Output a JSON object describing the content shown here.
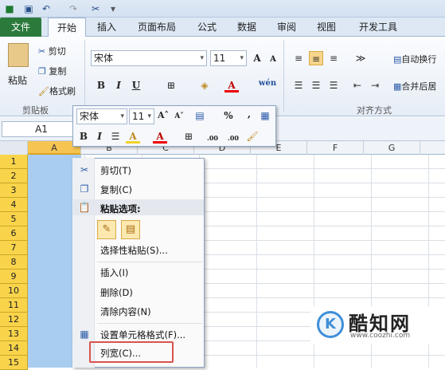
{
  "tabs": {
    "file": "文件",
    "home": "开始",
    "insert": "插入",
    "layout": "页面布局",
    "formula": "公式",
    "data": "数据",
    "review": "审阅",
    "view": "视图",
    "dev": "开发工具"
  },
  "ribbon": {
    "paste": "粘贴",
    "cut": "剪切",
    "copy": "复制",
    "format_painter": "格式刷",
    "clipboard_group": "剪贴板",
    "font_name": "宋体",
    "font_size": "11",
    "wrap": "自动换行",
    "merge": "合并后居",
    "align_group": "对齐方式",
    "bold": "B",
    "italic": "I",
    "underline": "U",
    "font_color": "A",
    "grow_font": "A",
    "shrink_font": "A",
    "wen": "wén"
  },
  "formula_bar": {
    "name_box": "A1"
  },
  "columns": [
    "A",
    "B",
    "C",
    "D",
    "E",
    "F",
    "G"
  ],
  "rows": [
    "1",
    "2",
    "3",
    "4",
    "5",
    "6",
    "7",
    "8",
    "9",
    "10",
    "11",
    "12",
    "13",
    "14",
    "15"
  ],
  "mini_toolbar": {
    "font_name": "宋体",
    "font_size": "11",
    "percent": "%",
    "comma": ",",
    "bold": "B",
    "italic": "I",
    "fill_color": "A",
    "font_color": "A",
    "inc_decimal": ".00",
    "dec_decimal": ".00"
  },
  "context_menu": {
    "cut": "剪切(T)",
    "copy": "复制(C)",
    "paste_options": "粘贴选项:",
    "paste_special": "选择性粘贴(S)...",
    "insert": "插入(I)",
    "delete": "删除(D)",
    "clear": "清除内容(N)",
    "format_cells": "设置单元格格式(F)...",
    "col_width": "列宽(C)..."
  },
  "watermark": {
    "name": "酷知网",
    "url": "www.coozhi.com",
    "logo": "K"
  },
  "colors": {
    "file_tab": "#2b7a3c",
    "row_header": "#f9d44b",
    "selection": "#a8cdf0",
    "highlight": "#d9534f"
  }
}
